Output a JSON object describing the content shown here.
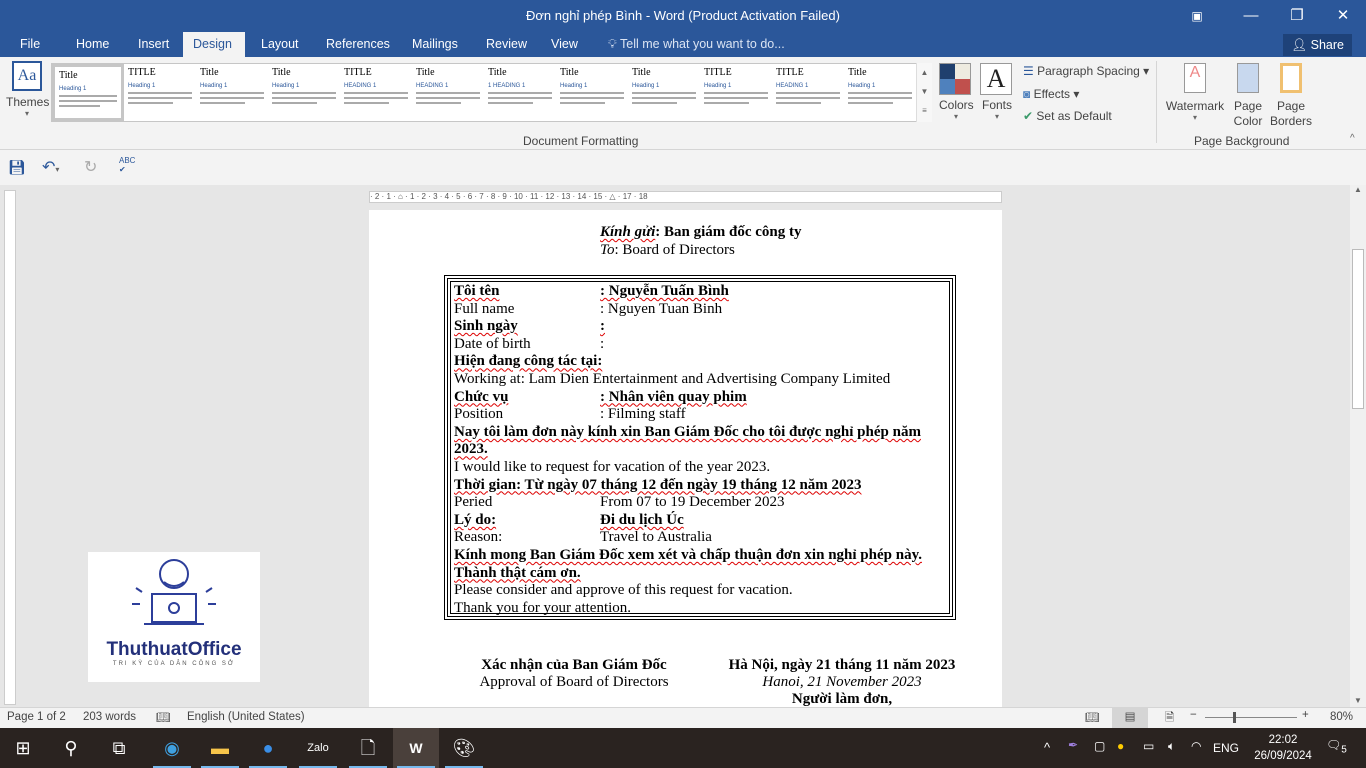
{
  "window": {
    "title": "Đơn nghỉ phép Bình - Word (Product Activation Failed)"
  },
  "tabs": [
    "File",
    "Home",
    "Insert",
    "Design",
    "Layout",
    "References",
    "Mailings",
    "Review",
    "View"
  ],
  "active_tab": "Design",
  "tell_me": "Tell me what you want to do...",
  "share": "Share",
  "ribbon": {
    "themes": "Themes",
    "gallery": [
      {
        "t": "Title",
        "h": "Heading 1"
      },
      {
        "t": "TITLE",
        "h": "Heading 1"
      },
      {
        "t": "Title",
        "h": "Heading 1"
      },
      {
        "t": "Title",
        "h": "Heading 1"
      },
      {
        "t": "TITLE",
        "h": "HEADING 1"
      },
      {
        "t": "Title",
        "h": "HEADING 1"
      },
      {
        "t": "Title",
        "h": "1 HEADING 1"
      },
      {
        "t": "Title",
        "h": "Heading 1"
      },
      {
        "t": "Title",
        "h": "Heading 1"
      },
      {
        "t": "TITLE",
        "h": "Heading 1"
      },
      {
        "t": "TITLE",
        "h": "HEADING 1"
      },
      {
        "t": "Title",
        "h": "Heading 1"
      }
    ],
    "colors": "Colors",
    "fonts": "Fonts",
    "paragraph_spacing": "Paragraph Spacing",
    "effects": "Effects",
    "set_default": "Set as Default",
    "doc_formatting": "Document Formatting",
    "watermark": "Watermark",
    "page_color": "Page Color",
    "page_borders": "Page Borders",
    "page_background": "Page Background"
  },
  "ruler": "· 2 · 1 · ⌂ · 1 · 2 · 3 · 4 · 5 · 6 · 7 · 8 · 9 · 10 · 11 · 12 · 13 · 14 · 15 · △ · 17 · 18",
  "doc": {
    "to_vi_label": "Kính gửi",
    "to_vi": ": Ban giám đốc công ty",
    "to_en_label": "To",
    "to_en": ": Board of Directors",
    "rows": [
      {
        "a": "Tôi tên",
        "b": ": Nguyễn Tuấn Bình",
        "bold": true
      },
      {
        "a": "Full name",
        "b": ": Nguyen Tuan Binh",
        "bold": false
      },
      {
        "a": "Sinh ngày",
        "b": ":",
        "bold": true
      },
      {
        "a": "Date of birth",
        "b": ":",
        "bold": false
      },
      {
        "a": "Hiện đang công tác tại:",
        "b": "",
        "bold": true
      },
      {
        "a": "Working at: Lam Dien Entertainment and Advertising Company Limited",
        "b": "",
        "bold": false
      },
      {
        "a": "Chức vụ",
        "b": ": Nhân viên quay phim",
        "bold": true
      },
      {
        "a": "Position",
        "b": ": Filming staff",
        "bold": false
      },
      {
        "a": "Nay tôi làm đơn này kính xin Ban Giám Đốc cho tôi được nghỉ phép năm",
        "b": "",
        "bold": true
      },
      {
        "a": "2023.",
        "b": "",
        "bold": true
      },
      {
        "a": "I would like to request for vacation of the year 2023.",
        "b": "",
        "bold": false
      },
      {
        "a": "Thời gian: Từ ngày 07 tháng 12 đến ngày 19 tháng 12 năm 2023",
        "b": "",
        "bold": true
      },
      {
        "a": "Peried",
        "b": "From 07 to 19 December 2023",
        "bold": false
      },
      {
        "a": "Lý do:",
        "b": "Đi du lịch Úc",
        "bold": true
      },
      {
        "a": "Reason:",
        "b": "Travel to Australia",
        "bold": false
      },
      {
        "a": "Kính mong Ban Giám Đốc xem xét và chấp thuận đơn xin nghỉ phép này.",
        "b": "",
        "bold": true
      },
      {
        "a": "Thành thật cám ơn.",
        "b": "",
        "bold": true
      },
      {
        "a": "Please consider and approve of this request for vacation.",
        "b": "",
        "bold": false
      },
      {
        "a": "Thank you for your attention.",
        "b": "",
        "bold": false
      }
    ],
    "approval_vi": "Xác nhận của Ban Giám Đốc",
    "approval_en": "Approval of Board of Directors",
    "date_vi": "Hà Nội, ngày 21 tháng 11 năm 2023",
    "date_en": "Hanoi, 21 November 2023",
    "applicant": "Người làm đơn,"
  },
  "watermark_logo": {
    "name": "ThuthuatOffice",
    "tagline": "TRI KỲ CỦA DÂN CÔNG SỞ"
  },
  "status": {
    "page": "Page 1 of 2",
    "words": "203 words",
    "language": "English (United States)",
    "zoom": "80%",
    "zoom_percent": 80
  },
  "taskbar": {
    "time": "22:02",
    "date": "26/09/2024",
    "lang": "ENG",
    "notifications": "5"
  },
  "colors": {
    "brand": "#2b579a"
  }
}
